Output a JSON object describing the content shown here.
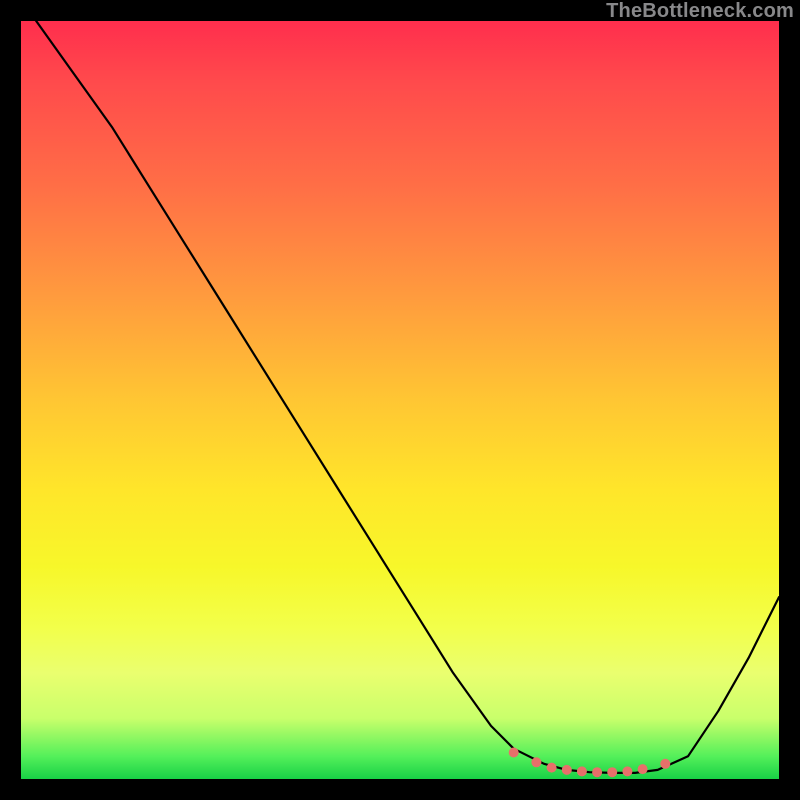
{
  "watermark": "TheBottleneck.com",
  "chart_data": {
    "type": "line",
    "title": "",
    "xlabel": "",
    "ylabel": "",
    "xlim": [
      0,
      100
    ],
    "ylim": [
      0,
      100
    ],
    "series": [
      {
        "name": "curve",
        "x": [
          2,
          7,
          12,
          17,
          22,
          27,
          32,
          37,
          42,
          47,
          52,
          57,
          62,
          65,
          69,
          72,
          75,
          78,
          81,
          84,
          88,
          92,
          96,
          100
        ],
        "y": [
          100,
          93,
          86,
          78,
          70,
          62,
          54,
          46,
          38,
          30,
          22,
          14,
          7,
          4,
          2,
          1.2,
          0.9,
          0.8,
          0.8,
          1.2,
          3,
          9,
          16,
          24
        ]
      }
    ],
    "markers": {
      "name": "low-band-points",
      "x": [
        65,
        68,
        70,
        72,
        74,
        76,
        78,
        80,
        82,
        85
      ],
      "y": [
        3.5,
        2.2,
        1.5,
        1.2,
        1.0,
        0.9,
        0.9,
        1.0,
        1.3,
        2.0
      ]
    },
    "marker_color": "#e7706a",
    "curve_color": "#000000"
  }
}
